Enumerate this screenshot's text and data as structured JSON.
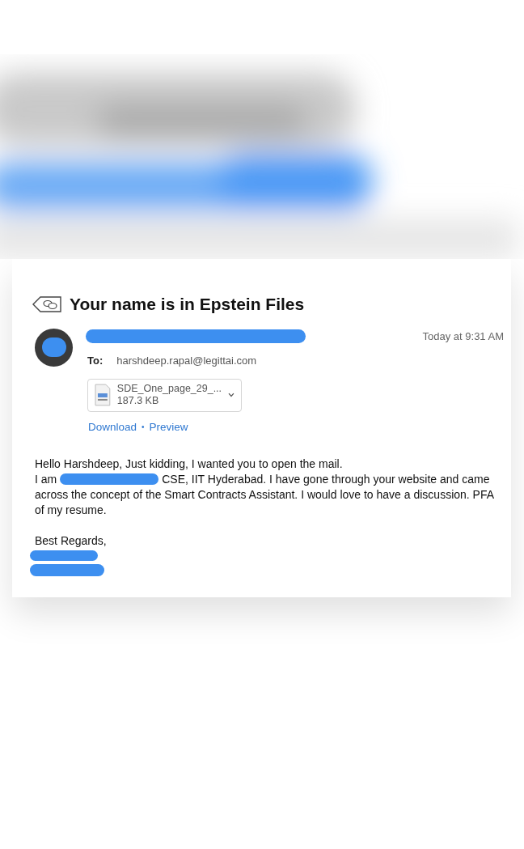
{
  "email": {
    "subject": "Your name is in Epstein Files",
    "time": "Today at 9:31 AM",
    "to_label": "To:",
    "to_address": "harshdeep.rapal@legittai.com",
    "attachment": {
      "name": "SDE_One_page_29_...",
      "size": "187.3 KB"
    },
    "actions": [
      "Download",
      "Preview"
    ],
    "action_separator": "•",
    "body": {
      "greeting": "Hello Harshdeep, Just kidding, I wanted you to open the mail.",
      "intro_start": "I am",
      "intro_rest": "CSE, IIT Hyderabad. I have gone through your website and came",
      "intro_continuation": "across the concept of the Smart Contracts Assistant. I would love to have a discussion. PFA of my resume.",
      "signoff": "Best Regards,"
    }
  }
}
